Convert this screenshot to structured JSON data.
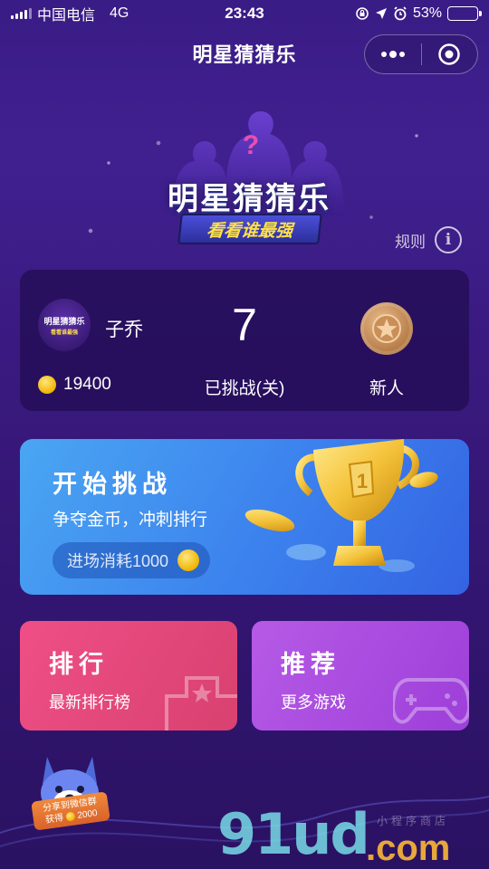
{
  "status_bar": {
    "carrier": "中国电信",
    "network": "4G",
    "time": "23:43",
    "battery_percent": "53%",
    "battery_level": 0.53
  },
  "nav": {
    "title": "明星猜猜乐",
    "more_icon": "more-dots-icon",
    "close_icon": "target-circle-icon"
  },
  "logo": {
    "title": "明星猜猜乐",
    "subtitle": "看看谁最强"
  },
  "rules": {
    "label": "规则",
    "icon": "info-icon"
  },
  "profile": {
    "avatar_title": "明星猜猜乐",
    "avatar_subtitle": "看看谁最强",
    "username": "子乔",
    "coins": "19400",
    "challenged_count": "7",
    "challenged_label": "已挑战(关)",
    "rank_title": "新人",
    "medal_icon": "star-medal-icon"
  },
  "start_challenge": {
    "title": "开始挑战",
    "subtitle": "争夺金币，冲刺排行",
    "entry_cost_label": "进场消耗1000",
    "trophy_icon": "trophy-icon"
  },
  "ranking_card": {
    "title": "排行",
    "subtitle": "最新排行榜"
  },
  "recommend_card": {
    "title": "推荐",
    "subtitle": "更多游戏"
  },
  "share": {
    "line1": "分享到微信群",
    "line2_prefix": "获得",
    "line2_amount": "2000"
  },
  "watermark": {
    "main": "91ud",
    "suffix": ".com",
    "small": "小程序商店"
  },
  "colors": {
    "background": "#3a1c86",
    "card_dark": "#240e58",
    "start_card": "#3c82ee",
    "ranking_card": "#ef4f86",
    "recommend_card": "#b65ae6",
    "coin": "#f0b400",
    "accent_yellow": "#ffe14a"
  }
}
